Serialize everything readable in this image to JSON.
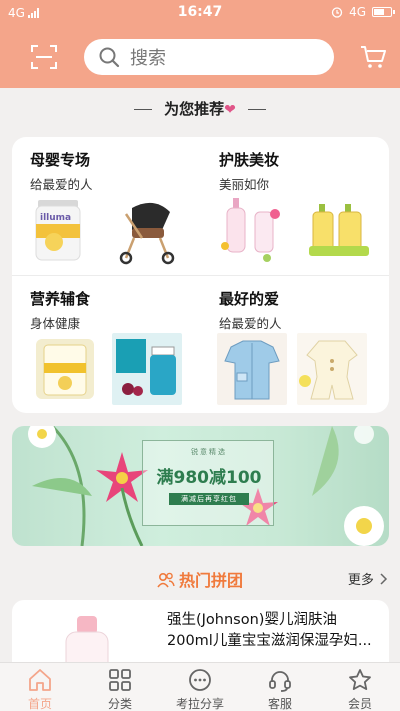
{
  "status": {
    "network": "4G",
    "time": "16:47",
    "network_right": "4G"
  },
  "header": {
    "search_placeholder": "搜索"
  },
  "recommend": {
    "title": "为您推荐"
  },
  "categories": [
    {
      "title": "母婴专场",
      "subtitle": "给最爱的人",
      "images": [
        "milk-powder",
        "stroller"
      ]
    },
    {
      "title": "护肤美妆",
      "subtitle": "美丽如你",
      "images": [
        "baby-lotion",
        "body-wash"
      ]
    },
    {
      "title": "营养辅食",
      "subtitle": "身体健康",
      "images": [
        "milk-powder-box",
        "vitamin-bottle"
      ]
    },
    {
      "title": "最好的爱",
      "subtitle": "给最爱的人",
      "images": [
        "baby-shirt",
        "baby-romper"
      ]
    }
  ],
  "banner": {
    "top_text": "锐意精选",
    "headline": "满980减100",
    "sub_text": "满减后再享红包"
  },
  "group_buy": {
    "title": "热门拼团",
    "more": "更多"
  },
  "product": {
    "name": "强生(Johnson)婴儿润肤油200ml儿童宝宝滋润保湿孕妇..."
  },
  "tabs": [
    {
      "label": "首页",
      "icon": "home-icon",
      "active": true
    },
    {
      "label": "分类",
      "icon": "grid-icon",
      "active": false
    },
    {
      "label": "考拉分享",
      "icon": "chat-icon",
      "active": false
    },
    {
      "label": "客服",
      "icon": "headset-icon",
      "active": false
    },
    {
      "label": "会员",
      "icon": "star-icon",
      "active": false
    }
  ],
  "colors": {
    "accent": "#f4a58a",
    "hot": "#f07a3c",
    "heart": "#e05588",
    "banner_green": "#2e7d4f"
  }
}
